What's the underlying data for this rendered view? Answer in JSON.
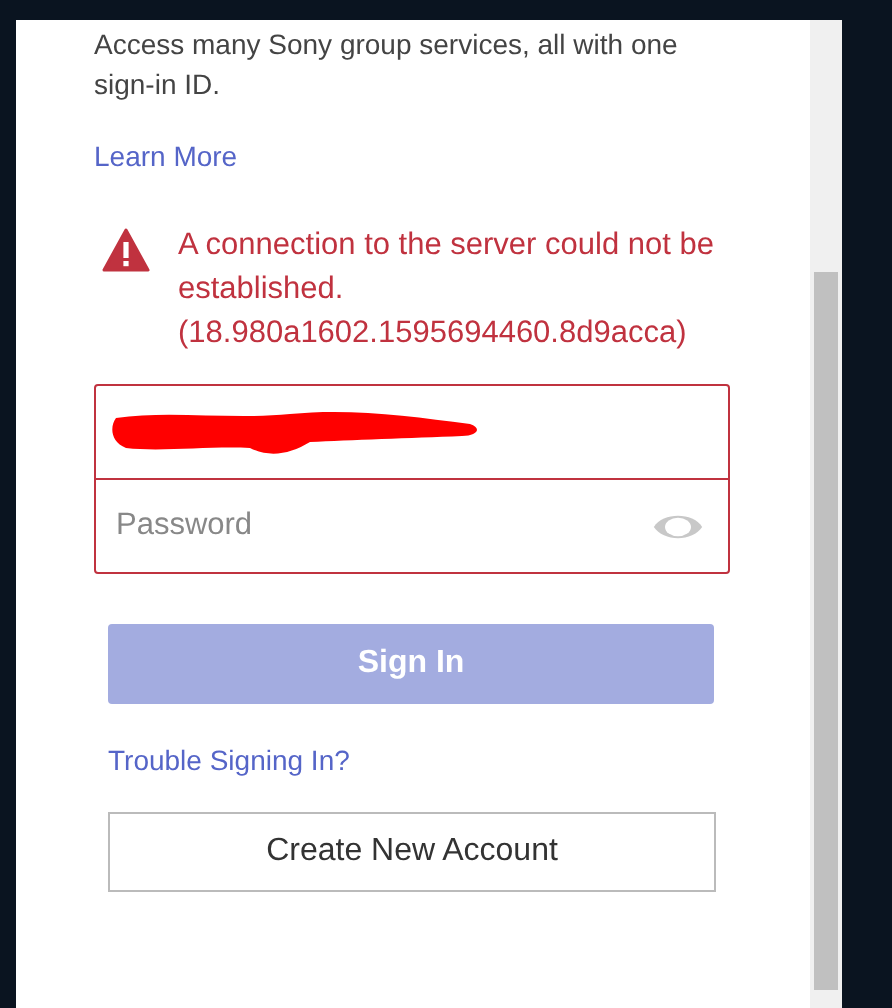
{
  "intro": "Access many Sony group services, all with one sign-in ID.",
  "learn_more": "Learn More",
  "error": {
    "lines": [
      "A connection to the server could not be established.",
      "(18.980a1602.1595694460.8d9acca)"
    ]
  },
  "fields": [
    {
      "kind": "email",
      "redacted": true
    },
    {
      "kind": "password",
      "placeholder": "Password"
    }
  ],
  "sign_in": {
    "label": "Sign In",
    "disabled": true
  },
  "trouble": "Trouble Signing In?",
  "create_account": "Create New Account"
}
